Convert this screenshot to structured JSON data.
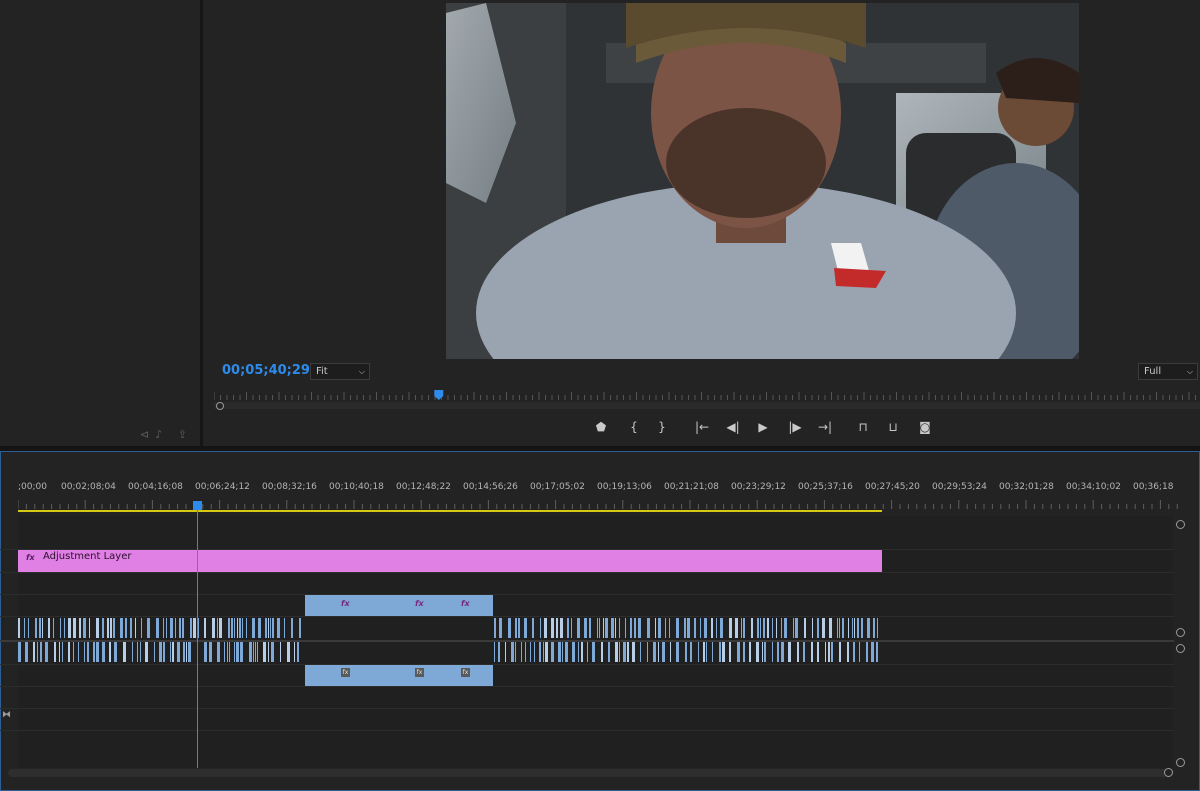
{
  "source_monitor": {
    "bottom_icons": "⊲♪ ⇪"
  },
  "program_monitor": {
    "timecode": "00;05;40;29",
    "zoom_select": "Fit",
    "quality_select": "Full",
    "playhead_fraction": 0.228
  },
  "transport": {
    "buttons": [
      {
        "name": "add-marker-button",
        "glyph": "⬟"
      },
      {
        "name": "mark-in-button",
        "glyph": "{"
      },
      {
        "name": "mark-out-button",
        "glyph": "}"
      },
      {
        "name": "go-to-in-button",
        "glyph": "|←"
      },
      {
        "name": "step-back-button",
        "glyph": "◀|"
      },
      {
        "name": "play-button",
        "glyph": "▶"
      },
      {
        "name": "step-forward-button",
        "glyph": "|▶"
      },
      {
        "name": "go-to-out-button",
        "glyph": "→|"
      },
      {
        "name": "lift-button",
        "glyph": "⊓"
      },
      {
        "name": "extract-button",
        "glyph": "⊔"
      },
      {
        "name": "export-frame-button",
        "glyph": "◙"
      }
    ]
  },
  "timeline": {
    "ruler_labels": [
      ";00;00",
      "00;02;08;04",
      "00;04;16;08",
      "00;06;24;12",
      "00;08;32;16",
      "00;10;40;18",
      "00;12;48;22",
      "00;14;56;26",
      "00;17;05;02",
      "00;19;13;06",
      "00;21;21;08",
      "00;23;29;12",
      "00;25;37;16",
      "00;27;45;20",
      "00;29;53;24",
      "00;32;01;28",
      "00;34;10;02",
      "00;36;18"
    ],
    "adjustment_clip": {
      "fx": "fx",
      "name": "Adjustment Layer"
    },
    "fx_label": "fx"
  },
  "colors": {
    "accent": "#2d8ceb",
    "adjustment_clip": "#e07fe4",
    "video_clip": "#7ea8d6",
    "work_area": "#d6c914"
  }
}
